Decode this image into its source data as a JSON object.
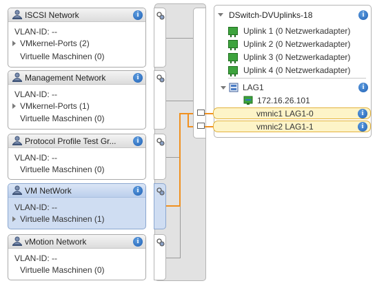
{
  "port_groups": [
    {
      "title": "ISCSI Network",
      "rows": [
        {
          "text": "VLAN-ID: --",
          "expander": false
        },
        {
          "text": "VMkernel-Ports (2)",
          "expander": true
        },
        {
          "text": "Virtuelle Maschinen (0)",
          "expander": false
        }
      ]
    },
    {
      "title": "Management Network",
      "rows": [
        {
          "text": "VLAN-ID: --",
          "expander": false
        },
        {
          "text": "VMkernel-Ports (1)",
          "expander": true
        },
        {
          "text": "Virtuelle Maschinen (0)",
          "expander": false
        }
      ]
    },
    {
      "title": "Protocol Profile Test Gr...",
      "rows": [
        {
          "text": "VLAN-ID: --",
          "expander": false
        },
        {
          "text": "Virtuelle Maschinen (0)",
          "expander": false
        }
      ]
    },
    {
      "title": "VM NetWork",
      "selected": true,
      "rows": [
        {
          "text": "VLAN-ID: --",
          "expander": false
        },
        {
          "text": "Virtuelle Maschinen (1)",
          "expander": true
        }
      ]
    },
    {
      "title": "vMotion Network",
      "rows": [
        {
          "text": "VLAN-ID: --",
          "expander": false
        },
        {
          "text": "Virtuelle Maschinen (0)",
          "expander": false
        }
      ]
    }
  ],
  "switch": {
    "title": "DSwitch-DVUplinks-18",
    "uplinks": [
      "Uplink 1 (0 Netzwerkadapter)",
      "Uplink 2 (0 Netzwerkadapter)",
      "Uplink 3 (0 Netzwerkadapter)",
      "Uplink 4 (0 Netzwerkadapter)"
    ],
    "lag": {
      "name": "LAG1",
      "ip": "172.16.26.101",
      "members": [
        "vmnic1 LAG1-0",
        "vmnic2 LAG1-1"
      ]
    }
  },
  "icons": {
    "port_group": "network-user-icon",
    "info": "info-icon",
    "uplink": "network-adapter-icon",
    "lag": "lag-icon",
    "vmkernel": "vmkernel-icon",
    "port": "port-icon"
  },
  "colors": {
    "selection": "#cfddf2",
    "connection": "#f0901e",
    "member_highlight": "#fdf4c8",
    "uplink_icon": "#3da33d",
    "info": "#1f5fb3"
  }
}
